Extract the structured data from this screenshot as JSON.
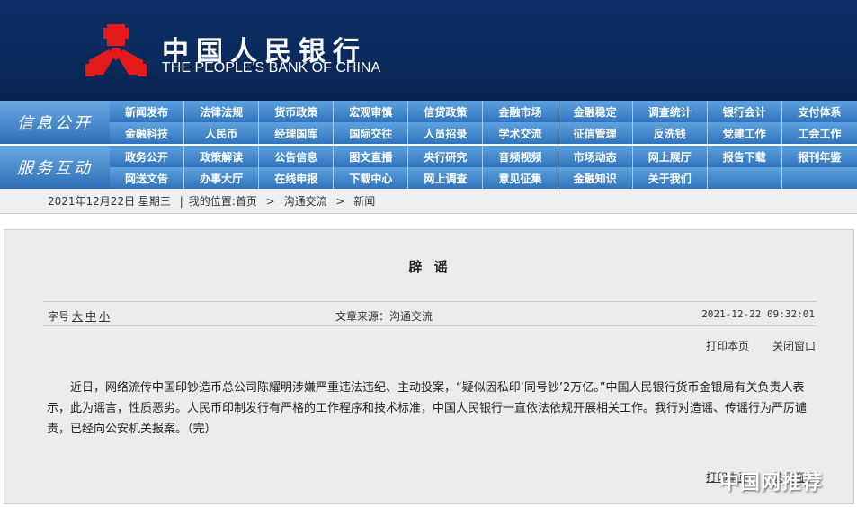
{
  "header": {
    "logo_cn": "中国人民银行",
    "logo_en": "THE PEOPLE'S BANK OF CHINA"
  },
  "nav": {
    "sections": [
      {
        "label": "信息公开",
        "rows": [
          [
            "新闻发布",
            "法律法规",
            "货币政策",
            "宏观审慎",
            "信贷政策",
            "金融市场",
            "金融稳定",
            "调查统计",
            "银行会计",
            "支付体系"
          ],
          [
            "金融科技",
            "人民币",
            "经理国库",
            "国际交往",
            "人员招录",
            "学术交流",
            "征信管理",
            "反洗钱",
            "党建工作",
            "工会工作"
          ]
        ]
      },
      {
        "label": "服务互动",
        "rows": [
          [
            "政务公开",
            "政策解读",
            "公告信息",
            "图文直播",
            "央行研究",
            "音频视频",
            "市场动态",
            "网上展厅",
            "报告下载",
            "报刊年鉴"
          ],
          [
            "网送文告",
            "办事大厅",
            "在线申报",
            "下载中心",
            "网上调查",
            "意见征集",
            "金融知识",
            "关于我们",
            "",
            ""
          ]
        ]
      }
    ]
  },
  "breadcrumb": {
    "date": "2021年12月22日 星期三",
    "sep": "|",
    "location_label": "我的位置:",
    "items": [
      "首页",
      "沟通交流",
      "新闻"
    ],
    "arrow": ">"
  },
  "article": {
    "title": "辟 谣",
    "font_size_label": "字号",
    "font_sizes": [
      "大",
      "中",
      "小"
    ],
    "source": "文章来源：沟通交流",
    "datetime": "2021-12-22 09:32:01",
    "print": "打印本页",
    "close": "关闭窗口",
    "body": "近日，网络流传中国印钞造币总公司陈耀明涉嫌严重违法违纪、主动投案，“疑似因私印‘同号钞’2万亿。”中国人民银行货币金银局有关负责人表示，此为谣言，性质恶劣。人民币印制发行有严格的工作程序和技术标准，中国人民银行一直依法依规开展相关工作。我行对造谣、传谣行为严厉谴责，已经向公安机关报案。（完）"
  },
  "watermark": "中国网推荐",
  "colors": {
    "header": "#0a2a5c",
    "nav": "#2f73bd",
    "emblem": "#e31b1b"
  }
}
